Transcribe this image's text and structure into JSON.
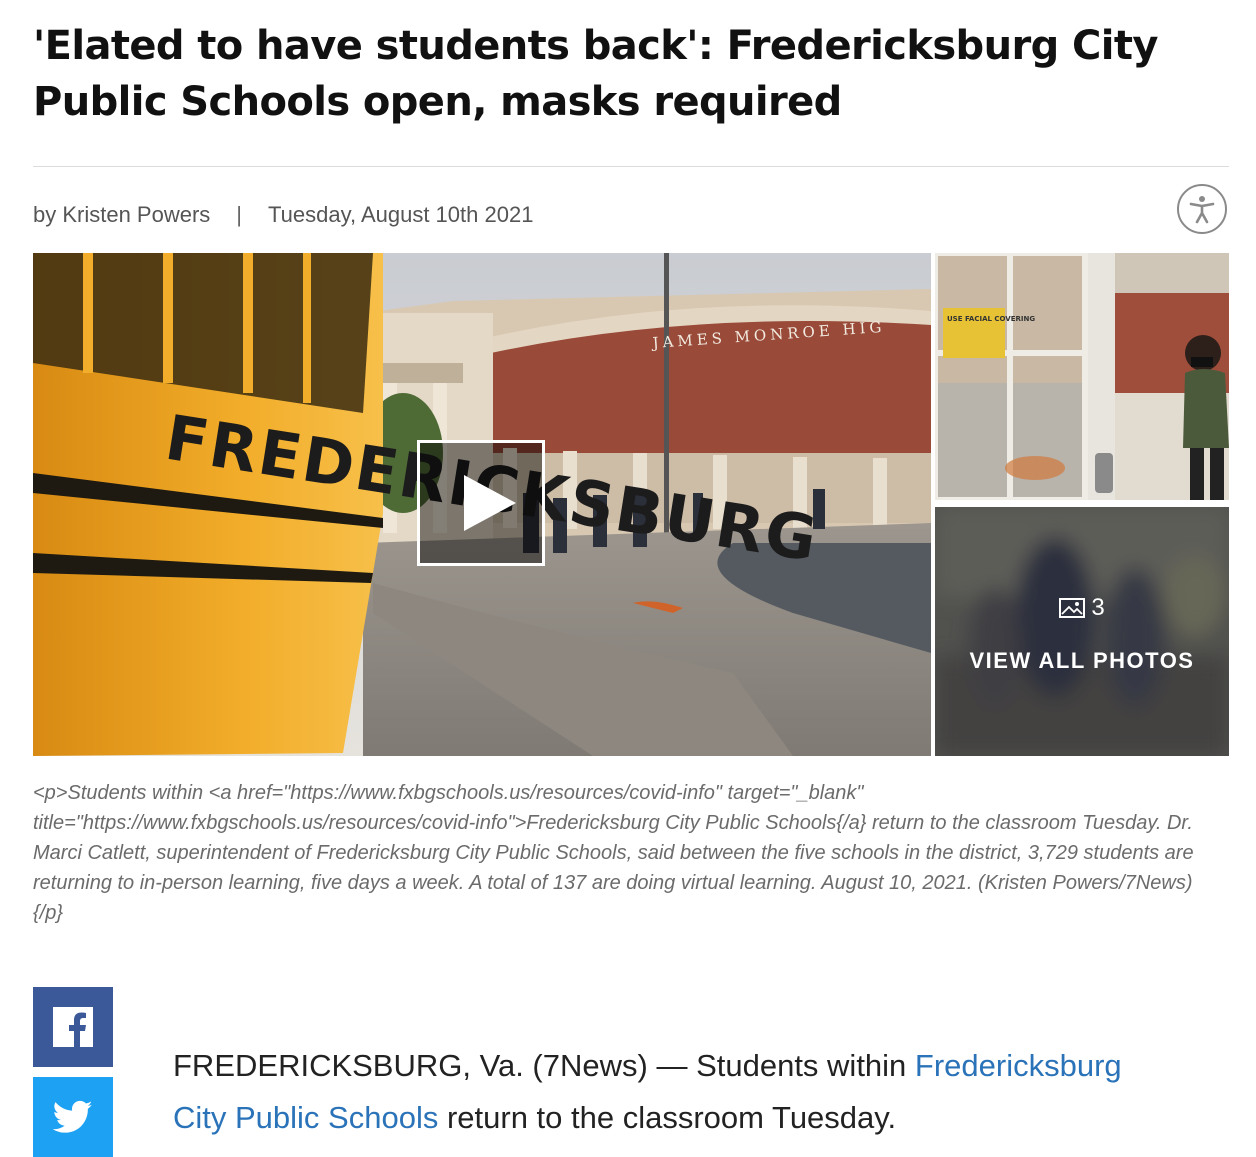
{
  "article": {
    "headline": "'Elated to have students back': Fredericksburg City Public Schools open, masks required",
    "byline": {
      "author": "by Kristen Powers",
      "separator": "|",
      "date": "Tuesday, August 10th 2021"
    }
  },
  "gallery": {
    "main_photo_sign": "JAMES MONROE HIG",
    "bus_lettering": "FREDERICKSBURG",
    "door_sign": "USE FACIAL COVERING",
    "photo_count": "3",
    "view_all_label": "VIEW ALL PHOTOS",
    "caption": "<p>Students within <a href=\"https://www.fxbgschools.us/resources/covid-info\" target=\"_blank\" title=\"https://www.fxbgschools.us/resources/covid-info\">Fredericksburg City Public Schools{/a} return to the classroom Tuesday. Dr. Marci Catlett, superintendent of Fredericksburg City Public Schools, said between the five schools in the district, 3,729 students are returning to in-person learning, five days a week. A total of 137 are doing virtual learning. August 10, 2021. (Kristen Powers/7News) {/p}"
  },
  "share": {
    "facebook_icon": "facebook-icon",
    "twitter_icon": "twitter-icon"
  },
  "body": {
    "lead_prefix": "FREDERICKSBURG, Va. (7News) — Students within ",
    "lead_link": "Fredericksburg City Public Schools",
    "lead_suffix": " return to the classroom Tuesday."
  },
  "colors": {
    "facebook": "#3b5998",
    "twitter": "#1da1f2",
    "link": "#2a73b8"
  }
}
